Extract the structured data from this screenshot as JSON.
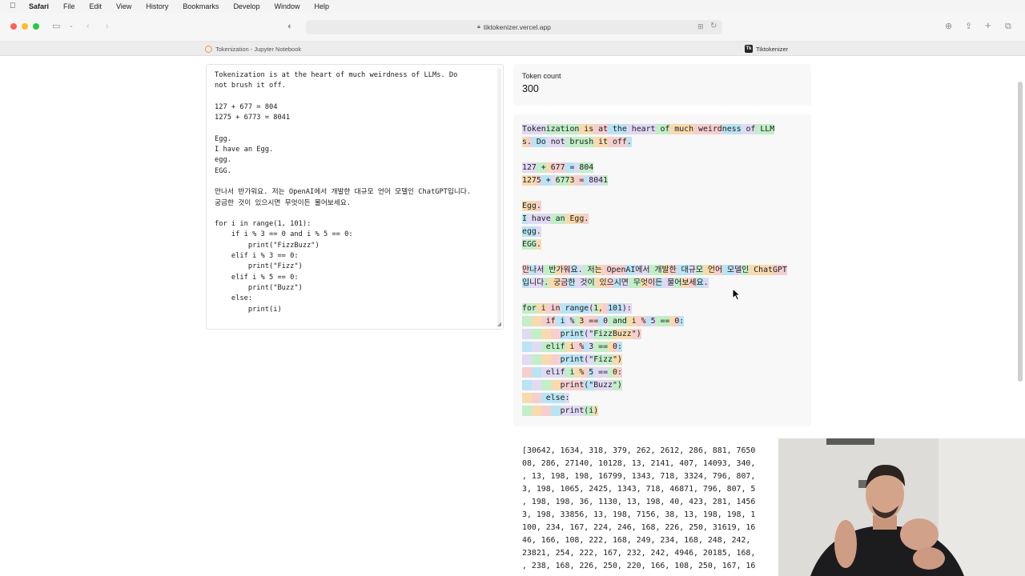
{
  "menubar": {
    "apple_icon": "apple-logo-icon",
    "items": [
      "Safari",
      "File",
      "Edit",
      "View",
      "History",
      "Bookmarks",
      "Develop",
      "Window",
      "Help"
    ]
  },
  "toolbar": {
    "url": "tiktokenizer.vercel.app",
    "icons": [
      "sidebar-icon",
      "back-icon",
      "forward-icon",
      "privacy-icon",
      "translate-icon",
      "reload-icon",
      "download-icon",
      "share-icon",
      "new-tab-icon",
      "tab-overview-icon"
    ]
  },
  "tabs": [
    {
      "label": "Tokenization - Jupyter Notebook",
      "icon": "jupyter-icon"
    },
    {
      "label": "Tiktokenizer",
      "icon": "tiktokenizer-icon",
      "favicon_text": "Tk"
    }
  ],
  "editor": {
    "text": "Tokenization is at the heart of much weirdness of LLMs. Do\nnot brush it off.\n\n127 + 677 = 804\n1275 + 6773 = 8041\n\nEgg.\nI have an Egg.\negg.\nEGG.\n\n만나서 반가워요. 저는 OpenAI에서 개발한 대규모 언어 모델인 ChatGPT입니다.\n궁금한 것이 있으시면 무엇이든 물어보세요.\n\nfor i in range(1, 101):\n    if i % 3 == 0 and i % 5 == 0:\n        print(\"FizzBuzz\")\n    elif i % 3 == 0:\n        print(\"Fizz\")\n    elif i % 5 == 0:\n        print(\"Buzz\")\n    else:\n        print(i)"
  },
  "token_count": {
    "label": "Token count",
    "value": "300"
  },
  "token_lines": [
    [
      [
        "Token",
        0
      ],
      [
        "ization",
        1
      ],
      [
        " is",
        2
      ],
      [
        " at",
        3
      ],
      [
        " the",
        4
      ],
      [
        " heart",
        0
      ],
      [
        " of",
        1
      ],
      [
        " much",
        2
      ],
      [
        " weird",
        3
      ],
      [
        "ness",
        4
      ],
      [
        " of",
        0
      ],
      [
        " LLM",
        1
      ]
    ],
    [
      [
        "s",
        2
      ],
      [
        ".",
        3
      ],
      [
        " Do",
        4
      ],
      [
        " not",
        0
      ],
      [
        " brush",
        1
      ],
      [
        " it",
        2
      ],
      [
        " off",
        3
      ],
      [
        ".",
        4
      ]
    ],
    [],
    [
      [
        "127",
        0
      ],
      [
        " +",
        1
      ],
      [
        " ",
        2
      ],
      [
        "677",
        3
      ],
      [
        " =",
        4
      ],
      [
        " ",
        0
      ],
      [
        "804",
        1
      ]
    ],
    [
      [
        "127",
        2
      ],
      [
        "5",
        3
      ],
      [
        " +",
        4
      ],
      [
        " ",
        0
      ],
      [
        "677",
        1
      ],
      [
        "3",
        2
      ],
      [
        " =",
        3
      ],
      [
        " ",
        4
      ],
      [
        "804",
        0
      ],
      [
        "1",
        1
      ]
    ],
    [],
    [
      [
        "Egg",
        2
      ],
      [
        ".",
        3
      ]
    ],
    [
      [
        "I",
        4
      ],
      [
        " have",
        0
      ],
      [
        " an",
        1
      ],
      [
        " Egg",
        2
      ],
      [
        ".",
        3
      ]
    ],
    [
      [
        "egg",
        4
      ],
      [
        ".",
        0
      ]
    ],
    [
      [
        "EGG",
        1
      ],
      [
        ".",
        2
      ]
    ],
    [],
    [
      [
        "만",
        3
      ],
      [
        "나",
        4
      ],
      [
        "서",
        0
      ],
      [
        " 반",
        1
      ],
      [
        "가",
        2
      ],
      [
        "워",
        3
      ],
      [
        "요",
        4
      ],
      [
        ".",
        0
      ],
      [
        " 저",
        1
      ],
      [
        "는",
        2
      ],
      [
        " Open",
        3
      ],
      [
        "AI",
        4
      ],
      [
        "에서",
        0
      ],
      [
        " 개",
        1
      ],
      [
        "발",
        2
      ],
      [
        "한",
        3
      ],
      [
        " 대",
        4
      ],
      [
        "규",
        0
      ],
      [
        "모",
        1
      ],
      [
        " 언",
        2
      ],
      [
        "어",
        3
      ],
      [
        " 모",
        4
      ],
      [
        "델",
        0
      ],
      [
        "인",
        1
      ],
      [
        " Chat",
        2
      ],
      [
        "GPT",
        3
      ]
    ],
    [
      [
        "입",
        4
      ],
      [
        "니다",
        0
      ],
      [
        ".",
        1
      ],
      [
        " 궁",
        2
      ],
      [
        "금",
        3
      ],
      [
        "한",
        4
      ],
      [
        " 것",
        0
      ],
      [
        "이",
        1
      ],
      [
        " 있",
        2
      ],
      [
        "으",
        3
      ],
      [
        "시",
        4
      ],
      [
        "면",
        0
      ],
      [
        " 무",
        1
      ],
      [
        "엇",
        2
      ],
      [
        "이",
        3
      ],
      [
        "든",
        4
      ],
      [
        " 물",
        0
      ],
      [
        "어",
        1
      ],
      [
        "보",
        2
      ],
      [
        "세",
        3
      ],
      [
        "요",
        4
      ],
      [
        ".",
        0
      ]
    ],
    [],
    [
      [
        "for",
        1
      ],
      [
        " i",
        2
      ],
      [
        " in",
        3
      ],
      [
        " range",
        4
      ],
      [
        "(",
        0
      ],
      [
        "1",
        1
      ],
      [
        ",",
        2
      ],
      [
        " ",
        3
      ],
      [
        "101",
        4
      ],
      [
        "):",
        0
      ]
    ],
    [
      [
        "  ",
        1
      ],
      [
        "  ",
        2
      ],
      [
        " if",
        3
      ],
      [
        " i",
        4
      ],
      [
        " %",
        0
      ],
      [
        " ",
        1
      ],
      [
        "3",
        2
      ],
      [
        " ==",
        3
      ],
      [
        " ",
        4
      ],
      [
        "0",
        0
      ],
      [
        " and",
        1
      ],
      [
        " i",
        2
      ],
      [
        " %",
        3
      ],
      [
        " ",
        4
      ],
      [
        "5",
        0
      ],
      [
        " ==",
        1
      ],
      [
        " ",
        2
      ],
      [
        "0",
        3
      ],
      [
        ":",
        4
      ]
    ],
    [
      [
        "  ",
        0
      ],
      [
        "  ",
        1
      ],
      [
        "  ",
        2
      ],
      [
        "  ",
        3
      ],
      [
        "print",
        4
      ],
      [
        "(\"",
        0
      ],
      [
        "Fizz",
        1
      ],
      [
        "Buzz",
        2
      ],
      [
        "\")",
        3
      ]
    ],
    [
      [
        "  ",
        4
      ],
      [
        "  ",
        0
      ],
      [
        " elif",
        1
      ],
      [
        " i",
        2
      ],
      [
        " %",
        3
      ],
      [
        " ",
        4
      ],
      [
        "3",
        0
      ],
      [
        " ==",
        1
      ],
      [
        " ",
        2
      ],
      [
        "0",
        3
      ],
      [
        ":",
        4
      ]
    ],
    [
      [
        "  ",
        0
      ],
      [
        "  ",
        1
      ],
      [
        "  ",
        2
      ],
      [
        "  ",
        3
      ],
      [
        "print",
        4
      ],
      [
        "(\"",
        0
      ],
      [
        "Fizz",
        1
      ],
      [
        "\")",
        2
      ]
    ],
    [
      [
        "  ",
        3
      ],
      [
        "  ",
        4
      ],
      [
        " elif",
        0
      ],
      [
        " i",
        1
      ],
      [
        " %",
        2
      ],
      [
        " ",
        3
      ],
      [
        "5",
        4
      ],
      [
        " ==",
        0
      ],
      [
        " ",
        1
      ],
      [
        "0",
        2
      ],
      [
        ":",
        3
      ]
    ],
    [
      [
        "  ",
        4
      ],
      [
        "  ",
        0
      ],
      [
        "  ",
        1
      ],
      [
        "  ",
        2
      ],
      [
        "print",
        3
      ],
      [
        "(\"",
        4
      ],
      [
        "Buzz",
        0
      ],
      [
        "\")",
        1
      ]
    ],
    [
      [
        "  ",
        2
      ],
      [
        "  ",
        3
      ],
      [
        " else",
        4
      ],
      [
        ":",
        0
      ]
    ],
    [
      [
        "  ",
        1
      ],
      [
        "  ",
        2
      ],
      [
        "  ",
        3
      ],
      [
        "  ",
        4
      ],
      [
        "print",
        0
      ],
      [
        "(i",
        1
      ],
      [
        ")",
        2
      ]
    ]
  ],
  "token_colors": [
    "#6b40d8",
    "#68de7a",
    "#f4ac36",
    "#ef4146",
    "#27b5ea"
  ],
  "token_ids": [
    "[30642, 1634, 318, 379, 262, 2612, 286, 881, 7650",
    "08, 286, 27140, 10128, 13, 2141, 407, 14093, 340,",
    ", 13, 198, 198, 16799, 1343, 718, 3324, 796, 807,",
    "3, 198, 1065, 2425, 1343, 718, 46871, 796, 807, 5",
    ", 198, 198, 36, 1130, 13, 198, 40, 423, 281, 1456",
    "3, 198, 33856, 13, 198, 7156, 38, 13, 198, 198, 1",
    "100, 234, 167, 224, 246, 168, 226, 250, 31619, 16",
    "46, 166, 108, 222, 168, 249, 234, 168, 248, 242,",
    "23821, 254, 222, 167, 232, 242, 4946, 20185, 168,",
    ", 238, 168, 226, 250, 220, 166, 108, 250, 167, 16"
  ],
  "cursor_icon": "arrow-cursor-icon",
  "webcam": {
    "icon": "presenter-webcam-icon"
  }
}
